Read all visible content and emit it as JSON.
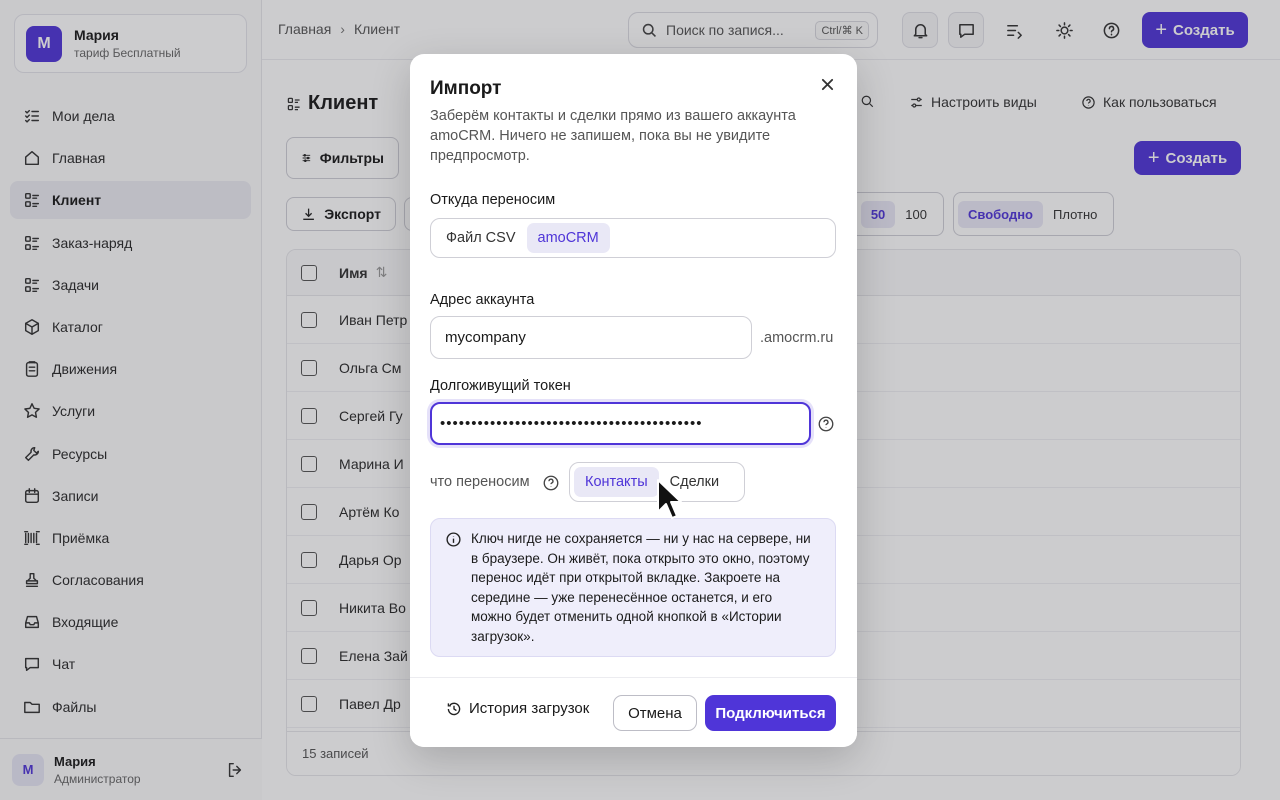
{
  "account": {
    "avatar_letter": "М",
    "name": "Мария",
    "plan": "тариф Бесплатный"
  },
  "sidebar": {
    "items": [
      {
        "label": "Мои дела",
        "icon": "checklist-icon",
        "active": false
      },
      {
        "label": "Главная",
        "icon": "home-icon",
        "active": false
      },
      {
        "label": "Клиент",
        "icon": "list-icon",
        "active": true
      },
      {
        "label": "Заказ-наряд",
        "icon": "list-icon",
        "active": false
      },
      {
        "label": "Задачи",
        "icon": "list-icon",
        "active": false
      },
      {
        "label": "Каталог",
        "icon": "box-icon",
        "active": false
      },
      {
        "label": "Движения",
        "icon": "clipboard-icon",
        "active": false
      },
      {
        "label": "Услуги",
        "icon": "star-icon",
        "active": false
      },
      {
        "label": "Ресурсы",
        "icon": "wrench-icon",
        "active": false
      },
      {
        "label": "Записи",
        "icon": "calendar-icon",
        "active": false
      },
      {
        "label": "Приёмка",
        "icon": "barcode-icon",
        "active": false
      },
      {
        "label": "Согласования",
        "icon": "stamp-icon",
        "active": false
      },
      {
        "label": "Входящие",
        "icon": "inbox-icon",
        "active": false
      },
      {
        "label": "Чат",
        "icon": "chat-icon",
        "active": false
      },
      {
        "label": "Файлы",
        "icon": "folder-icon",
        "active": false
      }
    ]
  },
  "user": {
    "avatar_letter": "М",
    "name": "Мария",
    "role": "Администратор"
  },
  "topbar": {
    "breadcrumb": [
      "Главная",
      "Клиент"
    ],
    "search_placeholder": "Поиск по запися...",
    "search_shortcut": "Ctrl/⌘ K",
    "create_label": "Создать"
  },
  "page": {
    "title": "Клиент",
    "configure_views": "Настроить виды",
    "how_to_use": "Как пользоваться",
    "filters": "Фильтры",
    "create": "Создать",
    "export": "Экспорт",
    "page_sizes": [
      "50",
      "100"
    ],
    "page_size_selected": "50",
    "density": [
      "Свободно",
      "Плотно"
    ],
    "density_selected": "Свободно",
    "table": {
      "header_name": "Имя",
      "rows": [
        "Иван Петр",
        "Ольга См",
        "Сергей Гу",
        "Марина И",
        "Артём Ко",
        "Дарья Ор",
        "Никита Во",
        "Елена Зай",
        "Павел Др"
      ],
      "footer": "15 записей"
    }
  },
  "modal": {
    "title": "Импорт",
    "description": "Заберём контакты и сделки прямо из вашего аккаунта amoCRM. Ничего не запишем, пока вы не увидите предпросмотр.",
    "source_label": "Откуда переносим",
    "source_options": [
      "Файл CSV",
      "amoCRM"
    ],
    "source_selected": "amoCRM",
    "account_label": "Адрес аккаунта",
    "account_value": "mycompany",
    "account_suffix": ".amocrm.ru",
    "token_label": "Долгоживущий токен",
    "token_value": "••••••••••••••••••••••••••••••••••••••••••",
    "what_label": "что переносим",
    "what_options": [
      "Контакты",
      "Сделки"
    ],
    "what_selected": "Контакты",
    "info_text": "Ключ нигде не сохраняется — ни у нас на сервере, ни в браузере. Он живёт, пока открыто это окно, поэтому перенос идёт при открытой вкладке. Закроете на середине — уже перенесённое останется, и его можно будет отменить одной кнопкой в «Истории загрузок».",
    "history_button": "История загрузок",
    "cancel_button": "Отмена",
    "connect_button": "Подключиться"
  },
  "colors": {
    "accent": "#4f35d8",
    "accent_soft": "#e9e8f6",
    "info_bg": "#efeefb"
  }
}
